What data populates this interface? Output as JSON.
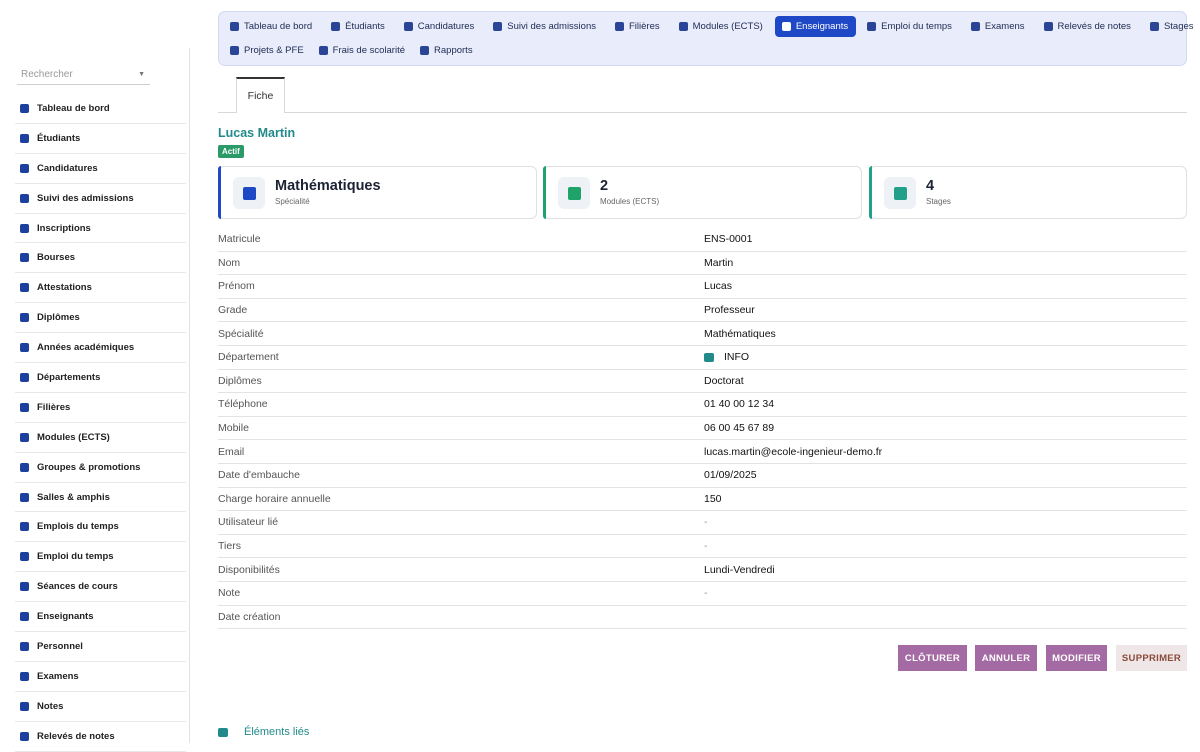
{
  "sidebar": {
    "search_placeholder": "Rechercher",
    "items": [
      {
        "label": "Tableau de bord",
        "icon": "dashboard-icon"
      },
      {
        "label": "Étudiants",
        "icon": "student-icon"
      },
      {
        "label": "Candidatures",
        "icon": "application-icon"
      },
      {
        "label": "Suivi des admissions",
        "icon": "admissions-icon"
      },
      {
        "label": "Inscriptions",
        "icon": "clipboard-icon"
      },
      {
        "label": "Bourses",
        "icon": "scholarship-icon"
      },
      {
        "label": "Attestations",
        "icon": "certificate-icon"
      },
      {
        "label": "Diplômes",
        "icon": "diploma-icon"
      },
      {
        "label": "Années académiques",
        "icon": "calendar-icon"
      },
      {
        "label": "Départements",
        "icon": "sitemap-icon"
      },
      {
        "label": "Filières",
        "icon": "graduation-cap-icon"
      },
      {
        "label": "Modules (ECTS)",
        "icon": "book-icon"
      },
      {
        "label": "Groupes & promotions",
        "icon": "laptop-icon"
      },
      {
        "label": "Salles & amphis",
        "icon": "building-icon"
      },
      {
        "label": "Emplois du temps",
        "icon": "calendar-icon"
      },
      {
        "label": "Emploi du temps",
        "icon": "calendar-icon"
      },
      {
        "label": "Séances de cours",
        "icon": "open-book-icon"
      },
      {
        "label": "Enseignants",
        "icon": "teacher-icon"
      },
      {
        "label": "Personnel",
        "icon": "users-icon"
      },
      {
        "label": "Examens",
        "icon": "document-icon"
      },
      {
        "label": "Notes",
        "icon": "star-icon"
      },
      {
        "label": "Relevés de notes",
        "icon": "document-icon"
      }
    ]
  },
  "topnav": {
    "row1": [
      {
        "label": "Tableau de bord",
        "icon": "dashboard-icon"
      },
      {
        "label": "Étudiants",
        "icon": "student-icon"
      },
      {
        "label": "Candidatures",
        "icon": "application-icon"
      },
      {
        "label": "Suivi des admissions",
        "icon": "admissions-icon"
      },
      {
        "label": "Filières",
        "icon": "graduation-cap-icon"
      },
      {
        "label": "Modules (ECTS)",
        "icon": "book-icon"
      },
      {
        "label": "Enseignants",
        "icon": "teacher-icon",
        "active": true
      },
      {
        "label": "Emploi du temps",
        "icon": "calendar-icon"
      },
      {
        "label": "Examens",
        "icon": "document-icon"
      },
      {
        "label": "Relevés de notes",
        "icon": "document-icon"
      },
      {
        "label": "Stages",
        "icon": "briefcase-icon"
      }
    ],
    "row2": [
      {
        "label": "Projets & PFE",
        "icon": "project-icon"
      },
      {
        "label": "Frais de scolarité",
        "icon": "invoice-icon"
      },
      {
        "label": "Rapports",
        "icon": "pie-chart-icon"
      }
    ],
    "active_color": "#1f48c6"
  },
  "tabs": {
    "fiche": "Fiche"
  },
  "header": {
    "name": "Lucas Martin",
    "status": "Actif"
  },
  "cards": [
    {
      "value": "Mathématiques",
      "label": "Spécialité",
      "icon": "teacher-icon",
      "color": "#1f48c6"
    },
    {
      "value": "2",
      "label": "Modules (ECTS)",
      "icon": "book-icon",
      "color": "#1fa36a"
    },
    {
      "value": "4",
      "label": "Stages",
      "icon": "briefcase-icon",
      "color": "#22a08a"
    }
  ],
  "fields": [
    {
      "key": "Matricule",
      "value": "ENS-0001"
    },
    {
      "key": "Nom",
      "value": "Martin"
    },
    {
      "key": "Prénom",
      "value": "Lucas"
    },
    {
      "key": "Grade",
      "value": "Professeur"
    },
    {
      "key": "Spécialité",
      "value": "Mathématiques"
    },
    {
      "key": "Département",
      "value": "INFO",
      "icon": "department-icon"
    },
    {
      "key": "Diplômes",
      "value": "Doctorat"
    },
    {
      "key": "Téléphone",
      "value": "01 40 00 12 34"
    },
    {
      "key": "Mobile",
      "value": "06 00 45 67 89"
    },
    {
      "key": "Email",
      "value": "lucas.martin@ecole-ingenieur-demo.fr"
    },
    {
      "key": "Date d'embauche",
      "value": "01/09/2025"
    },
    {
      "key": "Charge horaire annuelle",
      "value": "150"
    },
    {
      "key": "Utilisateur lié",
      "value": "-"
    },
    {
      "key": "Tiers",
      "value": "-"
    },
    {
      "key": "Disponibilités",
      "value": "Lundi-Vendredi"
    },
    {
      "key": "Note",
      "value": "-"
    },
    {
      "key": "Date création",
      "value": ""
    }
  ],
  "actions": {
    "close": "CLÔTURER",
    "cancel": "ANNULER",
    "edit": "MODIFIER",
    "delete": "SUPPRIMER"
  },
  "linked": {
    "label": "Éléments liés"
  }
}
